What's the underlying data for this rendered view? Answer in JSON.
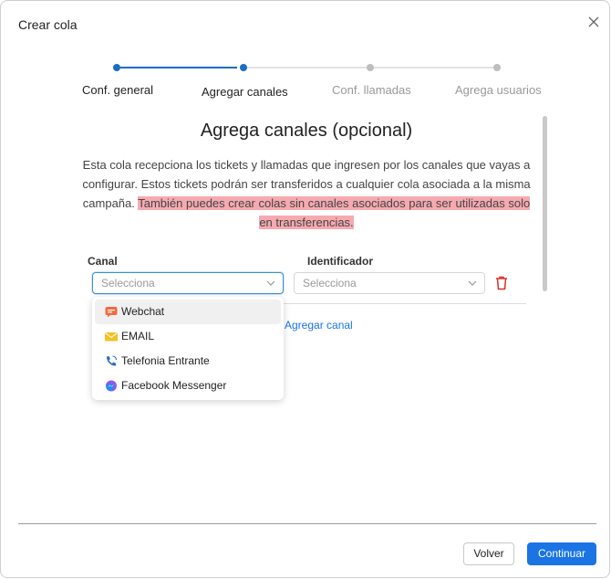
{
  "dialog": {
    "title": "Crear cola"
  },
  "stepper": {
    "steps": [
      {
        "label": "Conf. general",
        "state": "done"
      },
      {
        "label": "Agregar canales",
        "state": "active"
      },
      {
        "label": "Conf. llamadas",
        "state": "pending"
      },
      {
        "label": "Agrega usuarios",
        "state": "pending"
      }
    ]
  },
  "section": {
    "title": "Agrega canales (opcional)",
    "desc_plain": "Esta cola recepciona los tickets y llamadas que ingresen por los canales que vayas a configurar. Estos tickets podrán ser transferidos a cualquier cola asociada a la misma campaña. ",
    "desc_highlight": "También puedes crear colas sin canales asociados para ser utilizadas solo en transferencias."
  },
  "form": {
    "canal_label": "Canal",
    "identificador_label": "Identificador",
    "canal_placeholder": "Selecciona",
    "identificador_placeholder": "Selecciona",
    "add_channel": "Agregar canal"
  },
  "dropdown": {
    "options": [
      {
        "label": "Webchat",
        "icon": "webchat-icon",
        "highlighted": true
      },
      {
        "label": "EMAIL",
        "icon": "email-icon",
        "highlighted": false
      },
      {
        "label": "Telefonia Entrante",
        "icon": "phone-icon",
        "highlighted": false
      },
      {
        "label": "Facebook Messenger",
        "icon": "messenger-icon",
        "highlighted": false
      }
    ]
  },
  "footer": {
    "back": "Volver",
    "next": "Continuar"
  },
  "colors": {
    "primary": "#1b74e4",
    "highlight": "#f6aab0",
    "danger": "#d93025"
  }
}
